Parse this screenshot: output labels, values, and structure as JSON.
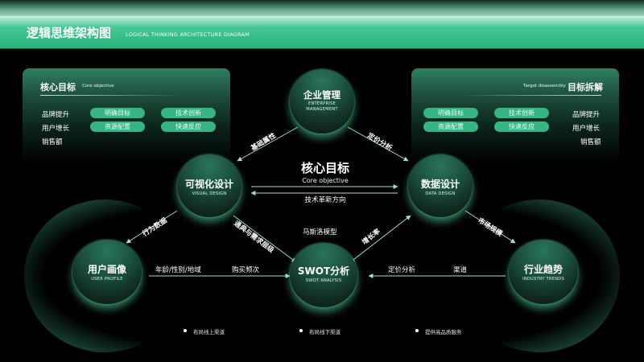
{
  "header": {
    "title": "逻辑思维架构图",
    "subtitle": "LOGICAL THINKING ARCHITECTURE DIAGRAM"
  },
  "left_panel": {
    "title": "核心目标",
    "subtitle": "Core objective",
    "labels": [
      "品牌提升",
      "用户增长",
      "销售额"
    ],
    "tags": [
      "明确目标",
      "技术创新",
      "资源配置",
      "快速反应"
    ]
  },
  "right_panel": {
    "title": "目标拆解",
    "subtitle": "Target disassembly",
    "labels": [
      "品牌提升",
      "用户增长",
      "销售额"
    ],
    "tags": [
      "明确目标",
      "技术创新",
      "资源配置",
      "快速反应"
    ]
  },
  "nodes": {
    "top": {
      "label": "企业管理",
      "en": "ENTERPRISE MANAGEMENT"
    },
    "visual": {
      "label": "可视化设计",
      "en": "VISUAL DESIGN"
    },
    "data": {
      "label": "数据设计",
      "en": "DATA DESIGN"
    },
    "user": {
      "label": "用户画像",
      "en": "USER PROFILE"
    },
    "swot": {
      "label": "SWOT分析",
      "en": "SWOT ANALYSIS"
    },
    "industry": {
      "label": "行业趋势",
      "en": "INDUSTRY TRENDS"
    }
  },
  "center": {
    "title": "核心目标",
    "subtitle": "Core objective",
    "tech": "技术革新方向",
    "model": "马斯洛模型"
  },
  "edges": {
    "top_visual": "基础属性",
    "top_data": "定价分析",
    "visual_user": "行为数据",
    "visual_swot": "通典与需求层级",
    "data_swot": "增长率",
    "data_industry": "市场规模",
    "user_swot_1": "年龄/性别/地域",
    "user_swot_2": "购买频次",
    "industry_swot_1": "定价分析",
    "industry_swot_2": "渠道"
  },
  "legend": [
    "布局线上渠道",
    "布局线下渠道",
    "提供高品质服务"
  ],
  "colors": {
    "accent": "#2fb67e",
    "pill": "#36b582",
    "glow": "#5ae6aa"
  }
}
